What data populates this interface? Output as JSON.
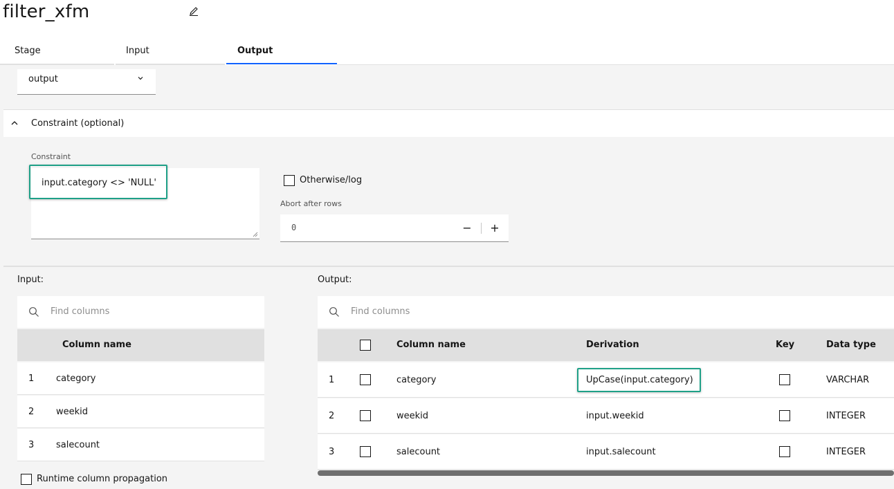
{
  "stage": {
    "title": "filter_xfm",
    "tabs": [
      {
        "label": "Stage"
      },
      {
        "label": "Input"
      },
      {
        "label": "Output"
      }
    ],
    "active_tab": "Output"
  },
  "link_select": {
    "value": "output"
  },
  "constraint_section": {
    "accordion_label": "Constraint (optional)",
    "constraint_label": "Constraint",
    "constraint_value": "input.category <> 'NULL'",
    "otherwise_label": "Otherwise/log",
    "otherwise_checked": false,
    "abort_label": "Abort after rows",
    "abort_value": "0",
    "minus_symbol": "−",
    "plus_symbol": "+"
  },
  "input_panel": {
    "label": "Input:",
    "search_placeholder": "Find columns",
    "column_header": "Column name",
    "rows": [
      {
        "num": "1",
        "name": "category"
      },
      {
        "num": "2",
        "name": "weekid"
      },
      {
        "num": "3",
        "name": "salecount"
      }
    ],
    "rcp_label": "Runtime column propagation",
    "rcp_checked": false
  },
  "output_panel": {
    "label": "Output:",
    "search_placeholder": "Find columns",
    "headers": {
      "column_name": "Column name",
      "derivation": "Derivation",
      "key": "Key",
      "data_type": "Data type"
    },
    "rows": [
      {
        "num": "1",
        "name": "category",
        "derivation": "UpCase(input.category)",
        "type": "VARCHAR"
      },
      {
        "num": "2",
        "name": "weekid",
        "derivation": "input.weekid",
        "type": "INTEGER"
      },
      {
        "num": "3",
        "name": "salecount",
        "derivation": "input.salecount",
        "type": "INTEGER"
      }
    ]
  },
  "colors": {
    "accent": "#0f62fe",
    "highlight": "#1ea087",
    "header_bg": "#e0e0e0",
    "panel_bg": "#f4f4f4"
  },
  "icons": [
    "edit-icon",
    "chevron-down-icon",
    "chevron-up-icon",
    "search-icon",
    "resize-grip-icon"
  ]
}
